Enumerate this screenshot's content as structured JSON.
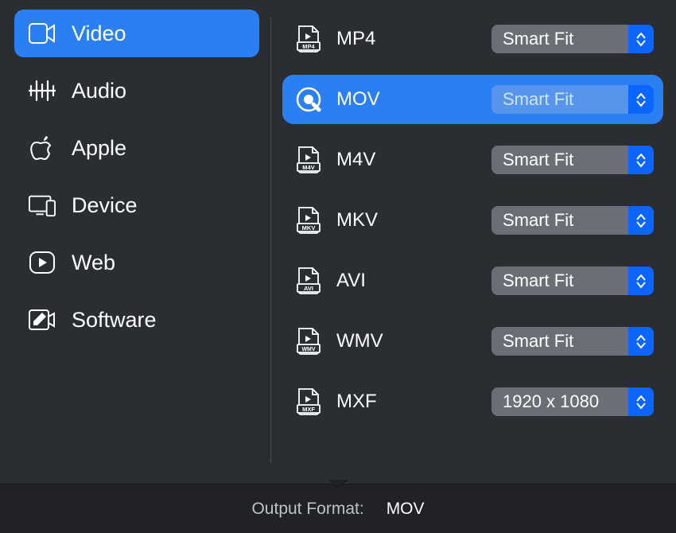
{
  "sidebar": {
    "items": [
      {
        "label": "Video",
        "active": true
      },
      {
        "label": "Audio",
        "active": false
      },
      {
        "label": "Apple",
        "active": false
      },
      {
        "label": "Device",
        "active": false
      },
      {
        "label": "Web",
        "active": false
      },
      {
        "label": "Software",
        "active": false
      }
    ]
  },
  "formats": [
    {
      "label": "MP4",
      "size": "Smart Fit",
      "active": false
    },
    {
      "label": "MOV",
      "size": "Smart Fit",
      "active": true
    },
    {
      "label": "M4V",
      "size": "Smart Fit",
      "active": false
    },
    {
      "label": "MKV",
      "size": "Smart Fit",
      "active": false
    },
    {
      "label": "AVI",
      "size": "Smart Fit",
      "active": false
    },
    {
      "label": "WMV",
      "size": "Smart Fit",
      "active": false
    },
    {
      "label": "MXF",
      "size": "1920 x 1080",
      "active": false
    }
  ],
  "footer": {
    "label": "Output Format:",
    "value": "MOV"
  }
}
